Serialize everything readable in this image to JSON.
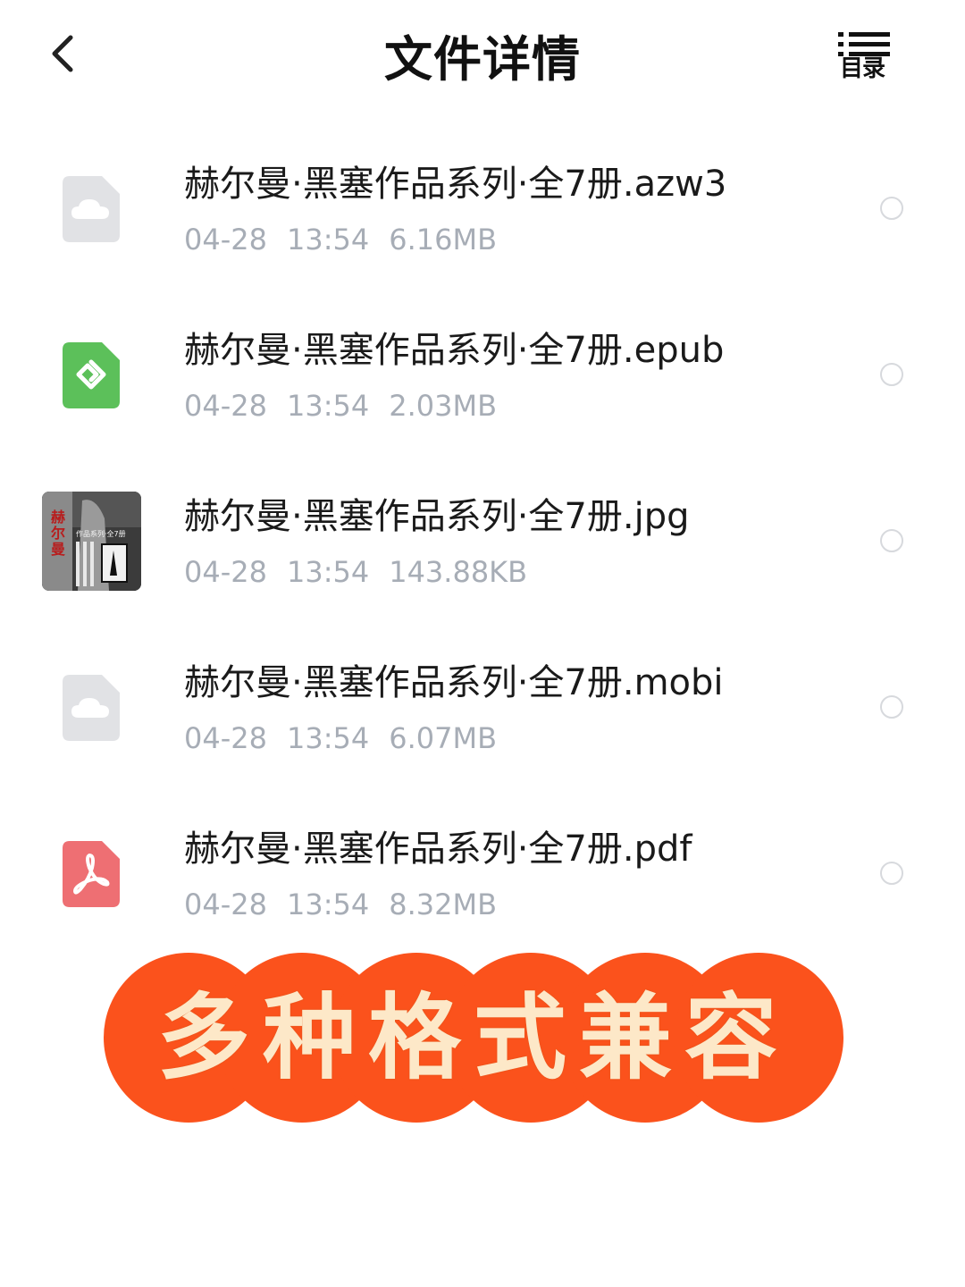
{
  "header": {
    "title": "文件详情",
    "back_icon": "chevron-left-icon",
    "toc_icon": "list-icon",
    "toc_label": "目录"
  },
  "files": [
    {
      "name": "赫尔曼·黑塞作品系列·全7册.azw3",
      "date": "04-28",
      "time": "13:54",
      "size": "6.16MB",
      "icon": "cloud-file-icon",
      "icon_color": "#e1e2e5"
    },
    {
      "name": "赫尔曼·黑塞作品系列·全7册.epub",
      "date": "04-28",
      "time": "13:54",
      "size": "2.03MB",
      "icon": "epub-file-icon",
      "icon_color": "#5cc05a"
    },
    {
      "name": "赫尔曼·黑塞作品系列·全7册.jpg",
      "date": "04-28",
      "time": "13:54",
      "size": "143.88KB",
      "icon": "image-thumbnail",
      "thumb_text": [
        "赫",
        "尔",
        "曼"
      ],
      "thumb_caption": "作品系列·全7册"
    },
    {
      "name": "赫尔曼·黑塞作品系列·全7册.mobi",
      "date": "04-28",
      "time": "13:54",
      "size": "6.07MB",
      "icon": "cloud-file-icon",
      "icon_color": "#e1e2e5"
    },
    {
      "name": "赫尔曼·黑塞作品系列·全7册.pdf",
      "date": "04-28",
      "time": "13:54",
      "size": "8.32MB",
      "icon": "pdf-file-icon",
      "icon_color": "#ee6f73"
    }
  ],
  "banner": {
    "text": "多种格式兼容",
    "bg_color": "#fb521c",
    "text_color": "#fde8c8"
  },
  "colors": {
    "meta_text": "#a7adb6",
    "radio_border": "#d7d9dd"
  }
}
